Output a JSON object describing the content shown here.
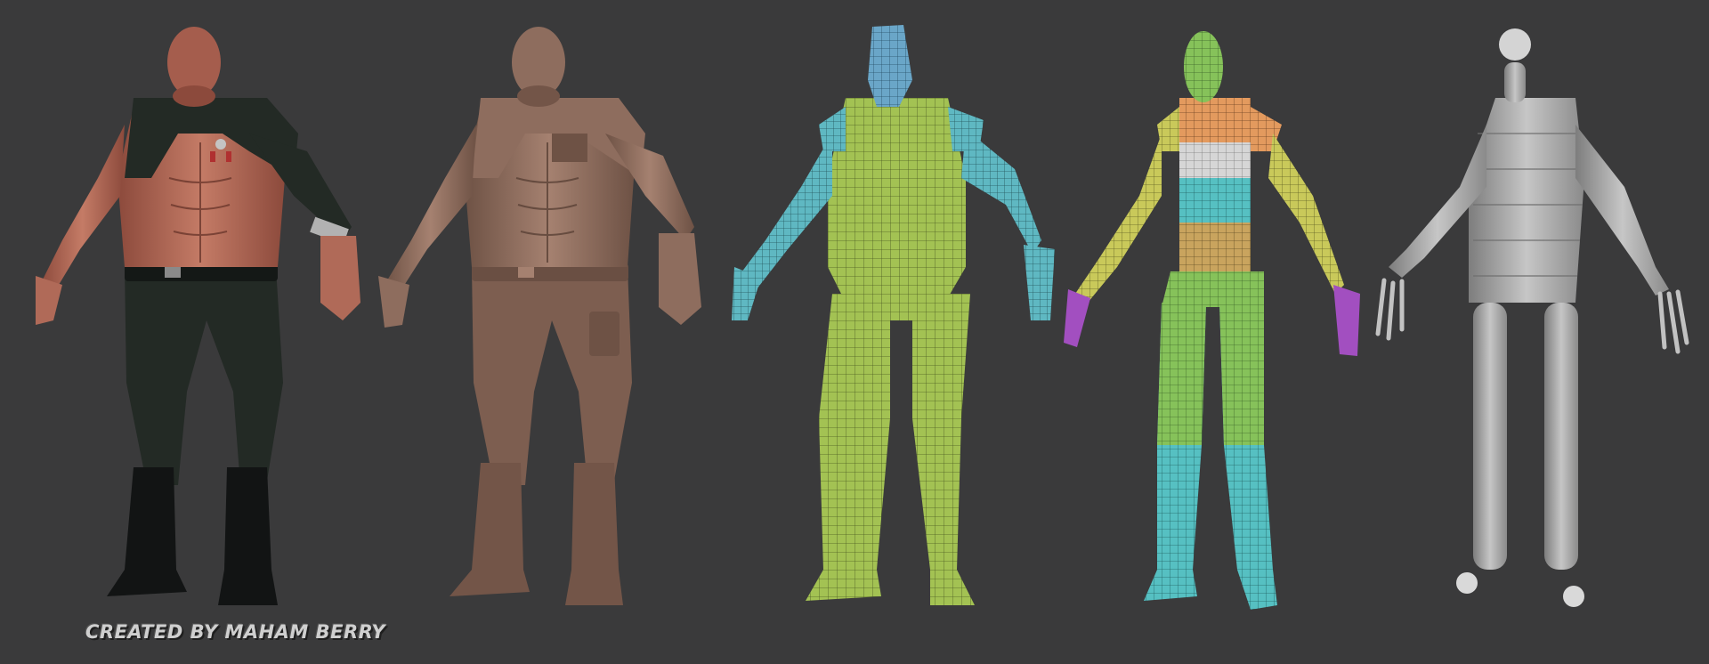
{
  "credit": {
    "text": "CREATED BY MAHAM BERRY"
  },
  "colors": {
    "background": "#3a3a3b",
    "skin": "#b06a58",
    "uniform": "#232a25",
    "sculpt_clay": "#8e6d5e",
    "topology_green": "#a3c253",
    "topology_cyan": "#5fb8c2",
    "uv_orange": "#e39a5e",
    "uv_white": "#d6d6d6",
    "uv_purple": "#a24fc0",
    "base_mesh_gray": "#9a9a9a"
  },
  "figures": [
    {
      "name": "textured-character",
      "style": "textured"
    },
    {
      "name": "clay-sculpt",
      "style": "clay"
    },
    {
      "name": "retopology-mesh",
      "style": "topology"
    },
    {
      "name": "polygroup-base",
      "style": "polygroups"
    },
    {
      "name": "zsphere-armature",
      "style": "armature"
    }
  ]
}
